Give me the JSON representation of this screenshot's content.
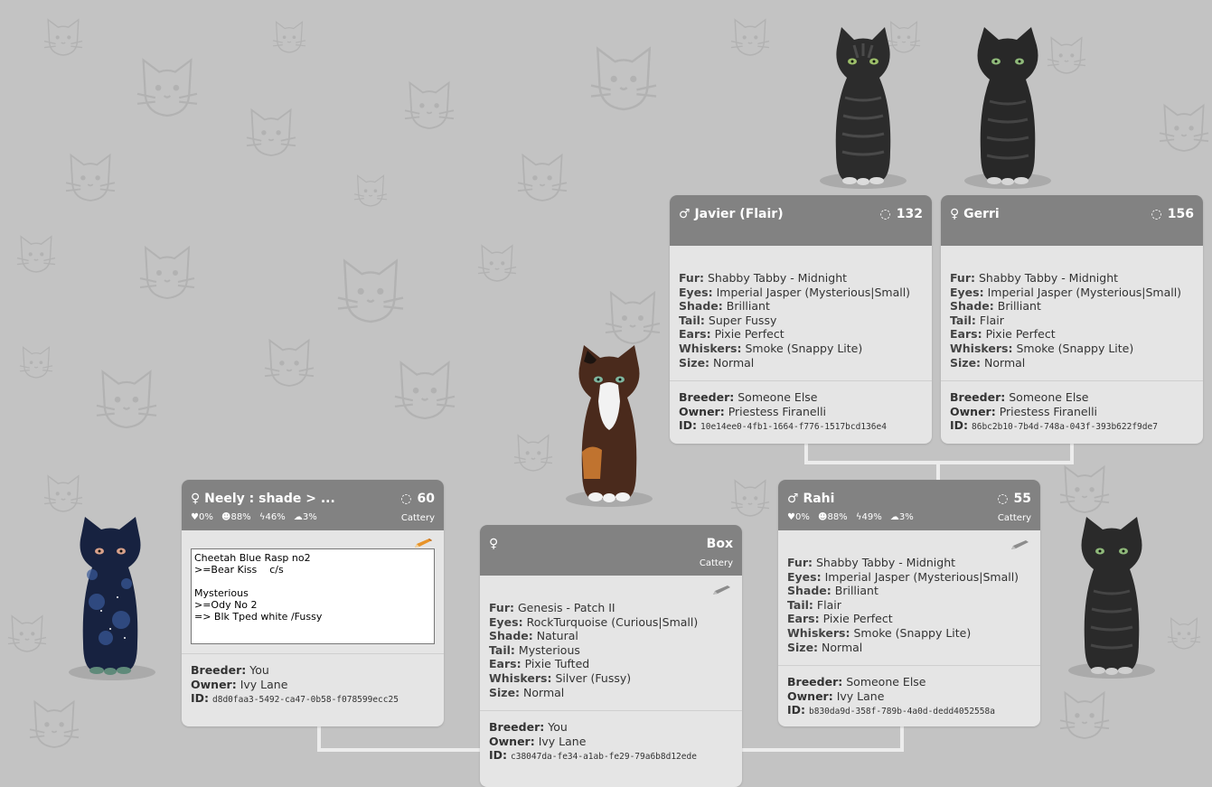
{
  "cards": {
    "javier": {
      "gender_icon": "♂",
      "name": "Javier (Flair)",
      "generation": "132",
      "fur_label": "Fur:",
      "fur": "Shabby Tabby - Midnight",
      "eyes_label": "Eyes:",
      "eyes": "Imperial Jasper (Mysterious|Small)",
      "shade_label": "Shade:",
      "shade": "Brilliant",
      "tail_label": "Tail:",
      "tail": "Super Fussy",
      "ears_label": "Ears:",
      "ears": "Pixie Perfect",
      "whiskers_label": "Whiskers:",
      "whiskers": "Smoke (Snappy Lite)",
      "size_label": "Size:",
      "size": "Normal",
      "breeder_label": "Breeder:",
      "breeder": "Someone Else",
      "owner_label": "Owner:",
      "owner": "Priestess Firanelli",
      "id_label": "ID:",
      "id": "10e14ee0-4fb1-1664-f776-1517bcd136e4"
    },
    "gerri": {
      "gender_icon": "♀",
      "name": "Gerri",
      "generation": "156",
      "fur_label": "Fur:",
      "fur": "Shabby Tabby - Midnight",
      "eyes_label": "Eyes:",
      "eyes": "Imperial Jasper (Mysterious|Small)",
      "shade_label": "Shade:",
      "shade": "Brilliant",
      "tail_label": "Tail:",
      "tail": "Flair",
      "ears_label": "Ears:",
      "ears": "Pixie Perfect",
      "whiskers_label": "Whiskers:",
      "whiskers": "Smoke (Snappy Lite)",
      "size_label": "Size:",
      "size": "Normal",
      "breeder_label": "Breeder:",
      "breeder": "Someone Else",
      "owner_label": "Owner:",
      "owner": "Priestess Firanelli",
      "id_label": "ID:",
      "id": "86bc2b10-7b4d-748a-043f-393b622f9de7"
    },
    "neely": {
      "gender_icon": "♀",
      "name": "Neely : shade > ...",
      "generation": "60",
      "stat_love": "♥0%",
      "stat_hunger": "☻88%",
      "stat_energy": "ϟ46%",
      "stat_sleep": "☁3%",
      "cattery": "Cattery",
      "note": "Cheetah Blue Rasp no2\n>=Bear Kiss    c/s\n\nMysterious\n>=Ody No 2\n=> Blk Tped white /Fussy",
      "breeder_label": "Breeder:",
      "breeder": "You",
      "owner_label": "Owner:",
      "owner": "Ivy Lane",
      "id_label": "ID:",
      "id": "d8d0faa3-5492-ca47-0b58-f078599ecc25"
    },
    "box": {
      "gender_icon": "♀",
      "name": "Box",
      "cattery": "Cattery",
      "fur_label": "Fur:",
      "fur": "Genesis - Patch II",
      "eyes_label": "Eyes:",
      "eyes": "RockTurquoise (Curious|Small)",
      "shade_label": "Shade:",
      "shade": "Natural",
      "tail_label": "Tail:",
      "tail": "Mysterious",
      "ears_label": "Ears:",
      "ears": "Pixie Tufted",
      "whiskers_label": "Whiskers:",
      "whiskers": "Silver (Fussy)",
      "size_label": "Size:",
      "size": "Normal",
      "breeder_label": "Breeder:",
      "breeder": "You",
      "owner_label": "Owner:",
      "owner": "Ivy Lane",
      "id_label": "ID:",
      "id": "c38047da-fe34-a1ab-fe29-79a6b8d12ede"
    },
    "rahi": {
      "gender_icon": "♂",
      "name": "Rahi",
      "generation": "55",
      "stat_love": "♥0%",
      "stat_hunger": "☻88%",
      "stat_energy": "ϟ49%",
      "stat_sleep": "☁3%",
      "cattery": "Cattery",
      "fur_label": "Fur:",
      "fur": "Shabby Tabby - Midnight",
      "eyes_label": "Eyes:",
      "eyes": "Imperial Jasper (Mysterious|Small)",
      "shade_label": "Shade:",
      "shade": "Brilliant",
      "tail_label": "Tail:",
      "tail": "Flair",
      "ears_label": "Ears:",
      "ears": "Pixie Perfect",
      "whiskers_label": "Whiskers:",
      "whiskers": "Smoke (Snappy Lite)",
      "size_label": "Size:",
      "size": "Normal",
      "breeder_label": "Breeder:",
      "breeder": "Someone Else",
      "owner_label": "Owner:",
      "owner": "Ivy Lane",
      "id_label": "ID:",
      "id": "b830da9d-358f-789b-4a0d-dedd4052558a"
    }
  },
  "icons": {
    "generation": "spinner-icon",
    "edit_active": "pencil-icon",
    "edit_disabled": "pencil-disabled-icon",
    "background": "cat-outline-pattern"
  },
  "colors": {
    "background": "#c3c3c3",
    "card_header": "#828282",
    "card_body": "#e5e5e5",
    "connector": "#ececec",
    "pencil": "#e8942a"
  }
}
